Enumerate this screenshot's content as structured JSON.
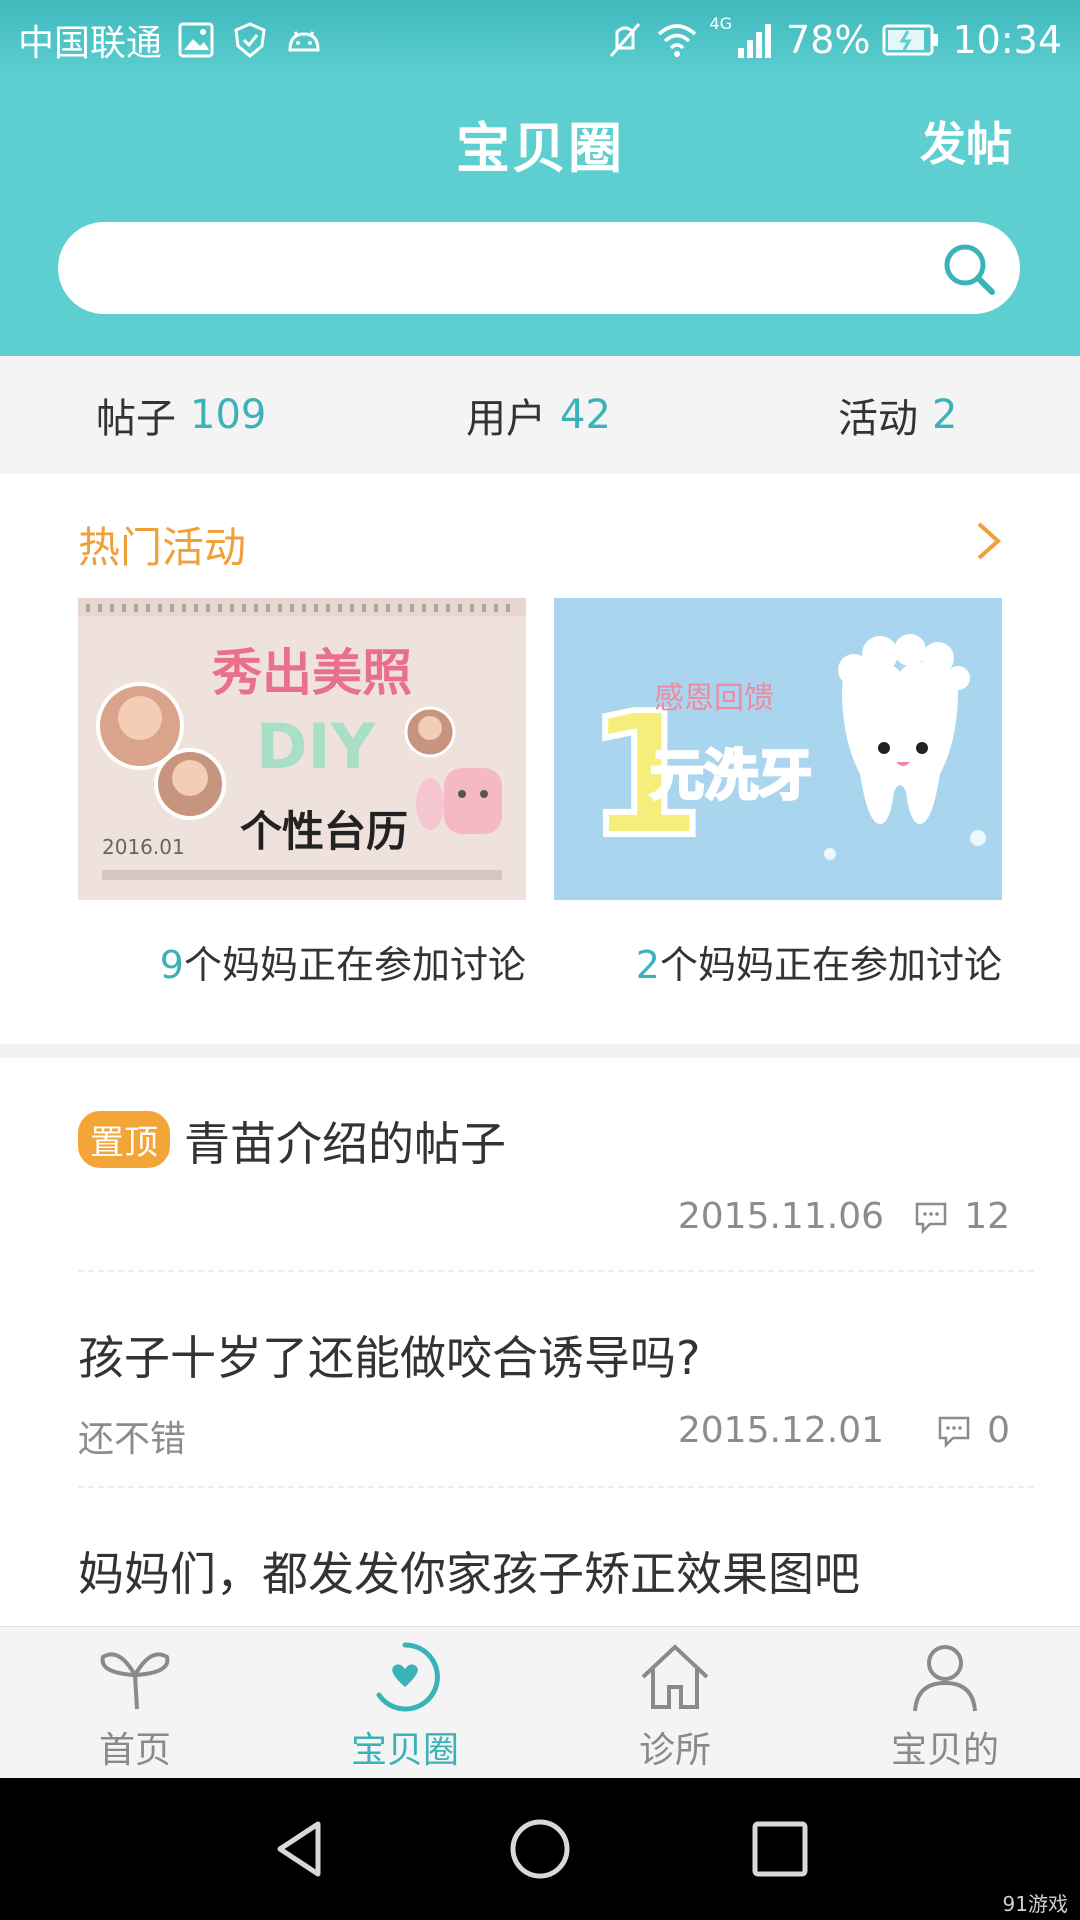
{
  "status_bar": {
    "carrier": "中国联通",
    "network": "4G",
    "battery": "78%",
    "time": "10:34"
  },
  "header": {
    "title": "宝贝圈",
    "post_button": "发帖",
    "search_placeholder": ""
  },
  "stats": [
    {
      "label": "帖子",
      "count": "109"
    },
    {
      "label": "用户",
      "count": "42"
    },
    {
      "label": "活动",
      "count": "2"
    }
  ],
  "hot_activities": {
    "title": "热门活动",
    "cards": [
      {
        "banner_lines": [
          "秀出美照",
          "DIY",
          "个性台历",
          "2016.01"
        ],
        "count": "9",
        "caption": "个妈妈正在参加讨论"
      },
      {
        "banner_lines": [
          "1",
          "感恩回馈",
          "元洗牙"
        ],
        "count": "2",
        "caption": "个妈妈正在参加讨论"
      }
    ]
  },
  "posts": [
    {
      "pinned_badge": "置顶",
      "title": "青苗介绍的帖子",
      "summary": "",
      "date": "2015.11.06",
      "comments": "12"
    },
    {
      "pinned_badge": "",
      "title": "孩子十岁了还能做咬合诱导吗?",
      "summary": "还不错",
      "date": "2015.12.01",
      "comments": "0"
    },
    {
      "pinned_badge": "",
      "title": "妈妈们，都发发你家孩子矫正效果图吧",
      "summary": "",
      "date": "",
      "comments": ""
    }
  ],
  "tabs": [
    {
      "label": "首页",
      "icon": "sprout-icon",
      "active": false
    },
    {
      "label": "宝贝圈",
      "icon": "heart-circle-icon",
      "active": true
    },
    {
      "label": "诊所",
      "icon": "house-icon",
      "active": false
    },
    {
      "label": "宝贝的",
      "icon": "user-icon",
      "active": false
    }
  ],
  "watermark": "91游戏",
  "colors": {
    "header": "#5ecfd0",
    "accent": "#3ab3b8",
    "hot_title": "#f0a03a",
    "pin_badge": "#f3a537"
  }
}
